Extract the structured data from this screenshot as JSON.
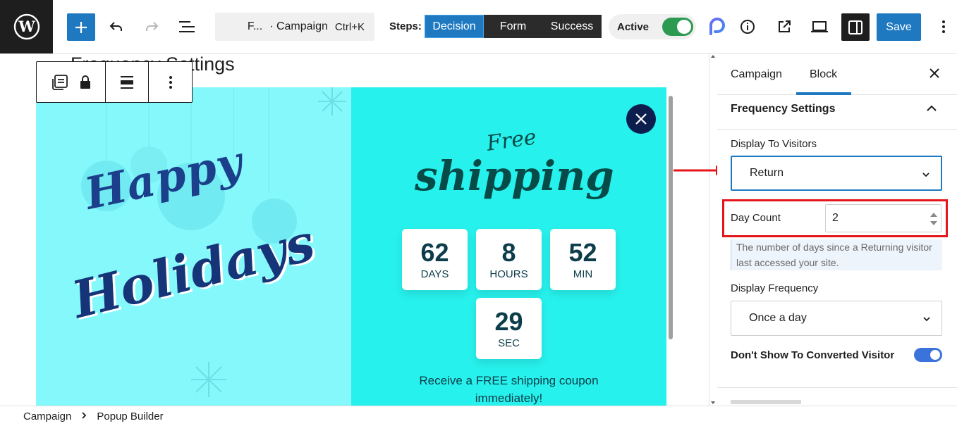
{
  "header": {
    "command_title": "F...",
    "command_subtitle": "· Campaign",
    "command_shortcut": "Ctrl+K",
    "steps_label": "Steps:",
    "steps": [
      "Decision",
      "Form",
      "Success"
    ],
    "active_step": "Decision",
    "status_label": "Active",
    "status_on": true,
    "save_label": "Save",
    "accent_color": "#1e79c1",
    "icons": [
      "wordpress-icon",
      "plus-icon",
      "undo-icon",
      "redo-icon",
      "list-view-icon",
      "plugin-logo-icon",
      "info-icon",
      "external-link-icon",
      "desktop-preview-icon",
      "sidebar-icon",
      "more-vertical-icon"
    ]
  },
  "canvas": {
    "heading": "Frequency Settings",
    "popup": {
      "left_title_1": "Happy",
      "left_title_2": "Holidays",
      "right_title_1": "Free",
      "right_title_2": "shipping",
      "countdown": [
        {
          "value": "62",
          "unit": "DAYS"
        },
        {
          "value": "8",
          "unit": "HOURS"
        },
        {
          "value": "52",
          "unit": "MIN"
        },
        {
          "value": "29",
          "unit": "SEC"
        }
      ],
      "promo_line_1": "Receive a FREE shipping coupon",
      "promo_line_2": "immediately!",
      "colors": {
        "left_bg": "#85f8fb",
        "right_bg": "#27f1ec",
        "text": "#0d3d4a"
      }
    }
  },
  "panel": {
    "tabs": [
      "Campaign",
      "Block"
    ],
    "active_tab": "Block",
    "section_title": "Frequency Settings",
    "display_to_visitors_label": "Display To Visitors",
    "display_to_visitors_value": "Return",
    "day_count_label": "Day Count",
    "day_count_value": "2",
    "day_count_help": "The number of days since a Returning visitor last accessed your site.",
    "display_frequency_label": "Display Frequency",
    "display_frequency_value": "Once a day",
    "converted_label": "Don't Show To Converted Visitor",
    "converted_on": true
  },
  "breadcrumb": [
    "Campaign",
    "Popup Builder"
  ]
}
